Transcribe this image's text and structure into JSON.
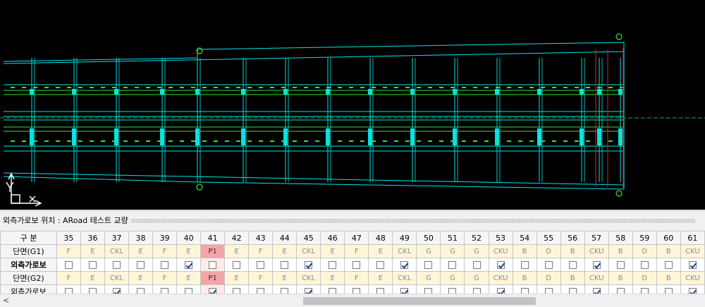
{
  "panel": {
    "title": "외측가로보 위치 : ARoad 테스트 교량"
  },
  "grid": {
    "header_label": "구 분",
    "columns": [
      "35",
      "36",
      "37",
      "38",
      "39",
      "40",
      "41",
      "42",
      "43",
      "44",
      "45",
      "46",
      "47",
      "48",
      "49",
      "50",
      "51",
      "52",
      "53",
      "54",
      "55",
      "56",
      "57",
      "58",
      "59",
      "60",
      "61"
    ],
    "rows": [
      {
        "label": "단면(G1)",
        "type": "section",
        "bold": false,
        "values": [
          "F",
          "E",
          "CKL",
          "E",
          "F",
          "E",
          "P1",
          "E",
          "F",
          "E",
          "CKL",
          "E",
          "F",
          "E",
          "CKL",
          "G",
          "G",
          "G",
          "CKU",
          "B",
          "D",
          "B",
          "CKU",
          "B",
          "D",
          "B",
          "CKU"
        ]
      },
      {
        "label": "외측가로보",
        "type": "check",
        "bold": true,
        "values": [
          false,
          false,
          false,
          false,
          false,
          true,
          false,
          false,
          false,
          false,
          true,
          false,
          false,
          false,
          true,
          false,
          false,
          false,
          true,
          false,
          false,
          false,
          true,
          false,
          false,
          false,
          true
        ]
      },
      {
        "label": "단면(G2)",
        "type": "section",
        "bold": false,
        "values": [
          "F",
          "E",
          "CKL",
          "E",
          "F",
          "E",
          "P1",
          "E",
          "F",
          "E",
          "CKL",
          "E",
          "F",
          "E",
          "CKL",
          "G",
          "G",
          "G",
          "CKU",
          "B",
          "D",
          "B",
          "CKU",
          "B",
          "D",
          "B",
          "CKU"
        ]
      },
      {
        "label": "외측가로보",
        "type": "check",
        "bold": false,
        "values": [
          false,
          false,
          true,
          false,
          false,
          false,
          true,
          false,
          false,
          false,
          true,
          false,
          false,
          false,
          true,
          false,
          false,
          false,
          true,
          false,
          false,
          false,
          true,
          false,
          false,
          false,
          true
        ]
      }
    ],
    "highlight_column": "41"
  },
  "scrollbar": {
    "left_arrow": "<"
  },
  "colors": {
    "cad_background": "#000000",
    "cad_outline": "#00e5e5",
    "cad_beam": "#38e03a",
    "cad_section_line": "#d01818",
    "p1_cell": "#f4a5a8",
    "section_row": "#fff6d9"
  },
  "icons": {
    "ucs": "ucs-axes-icon"
  }
}
